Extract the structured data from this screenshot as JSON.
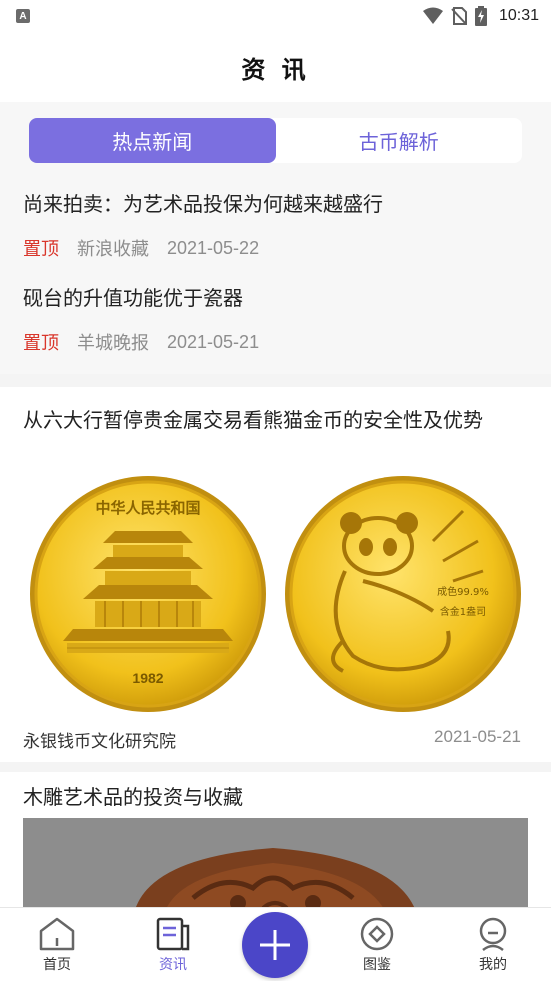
{
  "status_bar": {
    "time": "10:31",
    "badge": "A"
  },
  "header": {
    "title": "资 讯"
  },
  "tabs": [
    {
      "label": "热点新闻",
      "active": true
    },
    {
      "label": "古币解析",
      "active": false
    }
  ],
  "pinned_news": [
    {
      "title": "尚来拍卖：为艺术品投保为何越来越盛行",
      "pin": "置顶",
      "source": "新浪收藏",
      "date": "2021-05-22"
    },
    {
      "title": "砚台的升值功能优于瓷器",
      "pin": "置顶",
      "source": "羊城晚报",
      "date": "2021-05-21"
    }
  ],
  "articles": [
    {
      "title": "从六大行暂停贵金属交易看熊猫金币的安全性及优势",
      "source": "永银钱币文化研究院",
      "date": "2021-05-21",
      "coin_texts": {
        "left_top": "中华人民共和国",
        "left_year": "1982",
        "right_purity": "成色99.9%",
        "right_weight": "含金1盎司"
      }
    },
    {
      "title": "木雕艺术品的投资与收藏"
    }
  ],
  "bottom_nav": {
    "items": [
      {
        "label": "首页",
        "icon": "home-icon",
        "active": false
      },
      {
        "label": "资讯",
        "icon": "news-icon",
        "active": true
      },
      {
        "label": "图鉴",
        "icon": "coin-catalog-icon",
        "active": false
      },
      {
        "label": "我的",
        "icon": "profile-icon",
        "active": false
      }
    ],
    "fab_icon": "plus-icon"
  },
  "colors": {
    "accent": "#7b6fe0",
    "fab": "#4b46c8",
    "pin": "#d9362b",
    "coin_gold": "#f2c21c"
  }
}
